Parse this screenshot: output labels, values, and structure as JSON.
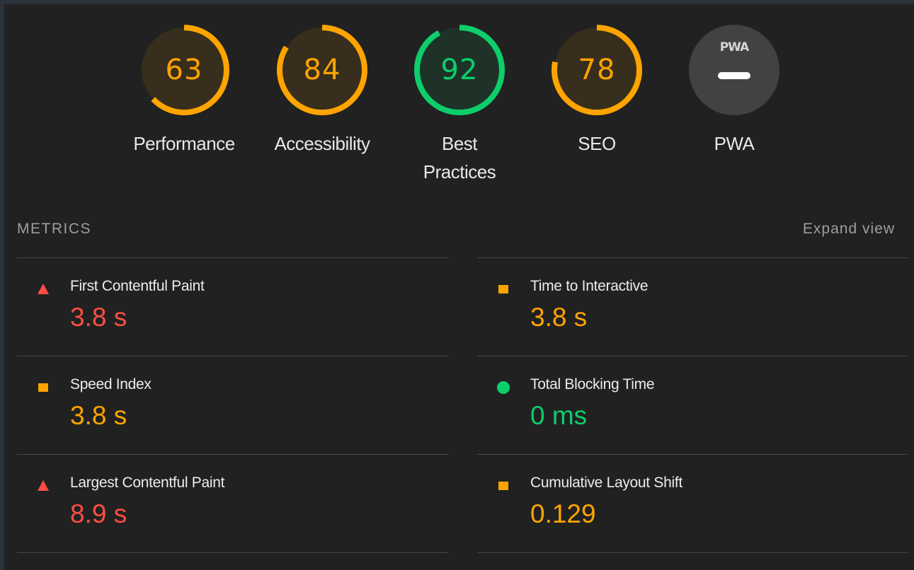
{
  "colors": {
    "fail": "#ff4e42",
    "average": "#ffa400",
    "pass": "#0cce6b",
    "pwa_badge": "#424242"
  },
  "categories": [
    {
      "label": "Performance",
      "score": "63",
      "value": 63,
      "rating": "average"
    },
    {
      "label": "Accessibility",
      "score": "84",
      "value": 84,
      "rating": "average"
    },
    {
      "label": "Best Practices",
      "label_lines": [
        "Best",
        "Practices"
      ],
      "score": "92",
      "value": 92,
      "rating": "pass"
    },
    {
      "label": "SEO",
      "score": "78",
      "value": 78,
      "rating": "average"
    },
    {
      "label": "PWA",
      "badge_text": "PWA",
      "badge_icon": "dash-icon"
    }
  ],
  "metrics_section": {
    "title": "METRICS",
    "expand_label": "Expand view"
  },
  "metrics": [
    {
      "name": "First Contentful Paint",
      "value": "3.8 s",
      "rating": "fail",
      "icon": "red-triangle-icon"
    },
    {
      "name": "Time to Interactive",
      "value": "3.8 s",
      "rating": "average",
      "icon": "orange-square-icon"
    },
    {
      "name": "Speed Index",
      "value": "3.8 s",
      "rating": "average",
      "icon": "orange-square-icon"
    },
    {
      "name": "Total Blocking Time",
      "value": "0 ms",
      "rating": "pass",
      "icon": "green-circle-icon"
    },
    {
      "name": "Largest Contentful Paint",
      "value": "8.9 s",
      "rating": "fail",
      "icon": "red-triangle-icon"
    },
    {
      "name": "Cumulative Layout Shift",
      "value": "0.129",
      "rating": "average",
      "icon": "orange-square-icon"
    }
  ]
}
